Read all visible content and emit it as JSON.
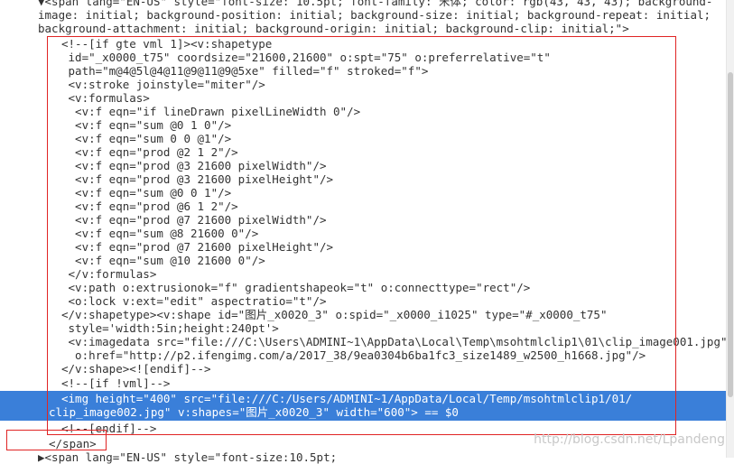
{
  "code": {
    "lines": [
      "▼<span lang=\"EN-US\" style=\"font-size: 10.5pt; font-family: 宋体; color: rgb(43, 43, 43); background-",
      "image: initial; background-position: initial; background-size: initial; background-repeat: initial;",
      "background-attachment: initial; background-origin: initial; background-clip: initial;\">",
      "<!--[if gte vml 1]><v:shapetype",
      " id=\"_x0000_t75\" coordsize=\"21600,21600\" o:spt=\"75\" o:preferrelative=\"t\"",
      " path=\"m@4@5l@4@11@9@11@9@5xe\" filled=\"f\" stroked=\"f\">",
      " <v:stroke joinstyle=\"miter\"/>",
      " <v:formulas>",
      "  <v:f eqn=\"if lineDrawn pixelLineWidth 0\"/>",
      "  <v:f eqn=\"sum @0 1 0\"/>",
      "  <v:f eqn=\"sum 0 0 @1\"/>",
      "  <v:f eqn=\"prod @2 1 2\"/>",
      "  <v:f eqn=\"prod @3 21600 pixelWidth\"/>",
      "  <v:f eqn=\"prod @3 21600 pixelHeight\"/>",
      "  <v:f eqn=\"sum @0 0 1\"/>",
      "  <v:f eqn=\"prod @6 1 2\"/>",
      "  <v:f eqn=\"prod @7 21600 pixelWidth\"/>",
      "  <v:f eqn=\"sum @8 21600 0\"/>",
      "  <v:f eqn=\"prod @7 21600 pixelHeight\"/>",
      "  <v:f eqn=\"sum @10 21600 0\"/>",
      " </v:formulas>",
      " <v:path o:extrusionok=\"f\" gradientshapeok=\"t\" o:connecttype=\"rect\"/>",
      " <o:lock v:ext=\"edit\" aspectratio=\"t\"/>",
      "</v:shapetype><v:shape id=\"图片_x0020_3\" o:spid=\"_x0000_i1025\" type=\"#_x0000_t75\"",
      " style='width:5in;height:240pt'>",
      " <v:imagedata src=\"file:///C:\\Users\\ADMINI~1\\AppData\\Local\\Temp\\msohtmlclip1\\01\\clip_image001.jpg\"",
      "  o:href=\"http://p2.ifengimg.com/a/2017_38/9ea0304b6ba1fc3_size1489_w2500_h1668.jpg\"/>",
      "</v:shape><![endif]-->",
      "<!--[if !vml]-->",
      "<img height=\"400\" src=\"file:///C:/Users/ADMINI~1/AppData/Local/Temp/msohtmlclip1/01/",
      "clip_image002.jpg\" v:shapes=\"图片_x0020_3\" width=\"600\"> == $0",
      "<!--[endif]-->",
      "</span>",
      "▶<span lang=\"EN-US\" style=\"font-size:10.5pt;"
    ]
  },
  "watermark": "http://blog.csdn.net/Lpandeng"
}
